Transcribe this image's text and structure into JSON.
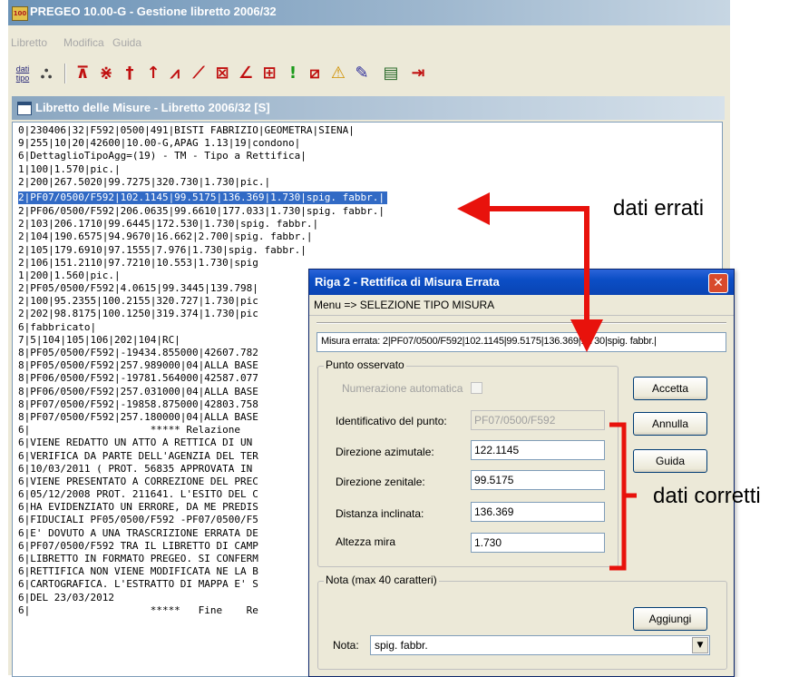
{
  "window": {
    "title": "PREGEO 10.00-G - Gestione libretto 2006/32"
  },
  "menu": [
    "Libretto",
    "Modifica",
    "Guida"
  ],
  "toolbar": {
    "dati_label_1": "dati",
    "dati_label_2": "tipo"
  },
  "document": {
    "title": "Libretto delle Misure - Libretto 2006/32 [S]",
    "lines": [
      "0|230406|32|F592|0500|491|BISTI FABRIZIO|GEOMETRA|SIENA|",
      "9|255|10|20|42600|10.00-G,APAG 1.13|19|condono|",
      "6|DettaglioTipoAgg=(19) - TM - Tipo a Rettifica|",
      "1|100|1.570|pic.|",
      "2|200|267.5020|99.7275|320.730|1.730|pic.|",
      "2|PF07/0500/F592|102.1145|99.5175|136.369|1.730|spig. fabbr.|",
      "2|PF06/0500/F592|206.0635|99.6610|177.033|1.730|spig. fabbr.|",
      "2|103|206.1710|99.6445|172.530|1.730|spig. fabbr.|",
      "2|104|190.6575|94.9670|16.662|2.700|spig. fabbr.|",
      "2|105|179.6910|97.1555|7.976|1.730|spig. fabbr.|",
      "2|106|151.2110|97.7210|10.553|1.730|spig",
      "1|200|1.560|pic.|",
      "2|PF05/0500/F592|4.0615|99.3445|139.798|",
      "2|100|95.2355|100.2155|320.727|1.730|pic",
      "2|202|98.8175|100.1250|319.374|1.730|pic",
      "6|fabbricato|",
      "7|5|104|105|106|202|104|RC|",
      "8|PF05/0500/F592|-19434.855000|42607.782",
      "8|PF05/0500/F592|257.989000|04|ALLA BASE",
      "8|PF06/0500/F592|-19781.564000|42587.077",
      "8|PF06/0500/F592|257.031000|04|ALLA BASE",
      "8|PF07/0500/F592|-19858.875000|42803.758",
      "8|PF07/0500/F592|257.180000|04|ALLA BASE",
      "6|                    ***** Relazione",
      "6|VIENE REDATTO UN ATTO A RETTICA DI UN",
      "6|VERIFICA DA PARTE DELL'AGENZIA DEL TER",
      "6|10/03/2011 ( PROT. 56835 APPROVATA IN",
      "6|VIENE PRESENTATO A CORREZIONE DEL PREC",
      "6|05/12/2008 PROT. 211641. L'ESITO DEL C",
      "6|HA EVIDENZIATO UN ERRORE, DA ME PREDIS",
      "6|FIDUCIALI PF05/0500/F592 -PF07/0500/F5",
      "6|E' DOVUTO A UNA TRASCRIZIONE ERRATA DE",
      "6|PF07/0500/F592 TRA IL LIBRETTO DI CAMP",
      "6|LIBRETTO IN FORMATO PREGEO. SI CONFERM",
      "6|RETTIFICA NON VIENE MODIFICATA NE LA B",
      "6|CARTOGRAFICA. L'ESTRATTO DI MAPPA E' S",
      "6|DEL 23/03/2012",
      "6|                    *****   Fine    Re"
    ],
    "highlighted_index": 5
  },
  "dialog": {
    "title": "Riga 2 - Rettifica di Misura Errata",
    "menu": "Menu => SELEZIONE TIPO MISURA",
    "misura_errata": "Misura errata: 2|PF07/0500/F592|102.1145|99.5175|136.369|1.730|spig. fabbr.|",
    "group_punto": "Punto osservato",
    "numerazione_label": "Numerazione automatica",
    "identificativo_label": "Identificativo del punto:",
    "identificativo_value": "PF07/0500/F592",
    "direzione_azimutale_label": "Direzione azimutale:",
    "direzione_azimutale_value": "122.1145",
    "direzione_zenitale_label": "Direzione zenitale:",
    "direzione_zenitale_value": "99.5175",
    "distanza_label": "Distanza inclinata:",
    "distanza_value": "136.369",
    "altezza_label": "Altezza mira",
    "altezza_value": "1.730",
    "btn_accetta": "Accetta",
    "btn_annulla": "Annulla",
    "btn_guida": "Guida",
    "group_nota": "Nota (max 40 caratteri)",
    "btn_aggiungi": "Aggiungi",
    "nota_label": "Nota:",
    "nota_value": "spig. fabbr."
  },
  "annotations": {
    "dati_errati": "dati errati",
    "dati_corretti": "dati corretti",
    "arrow_color": "#e8120c",
    "bracket_color": "#e8120c"
  }
}
